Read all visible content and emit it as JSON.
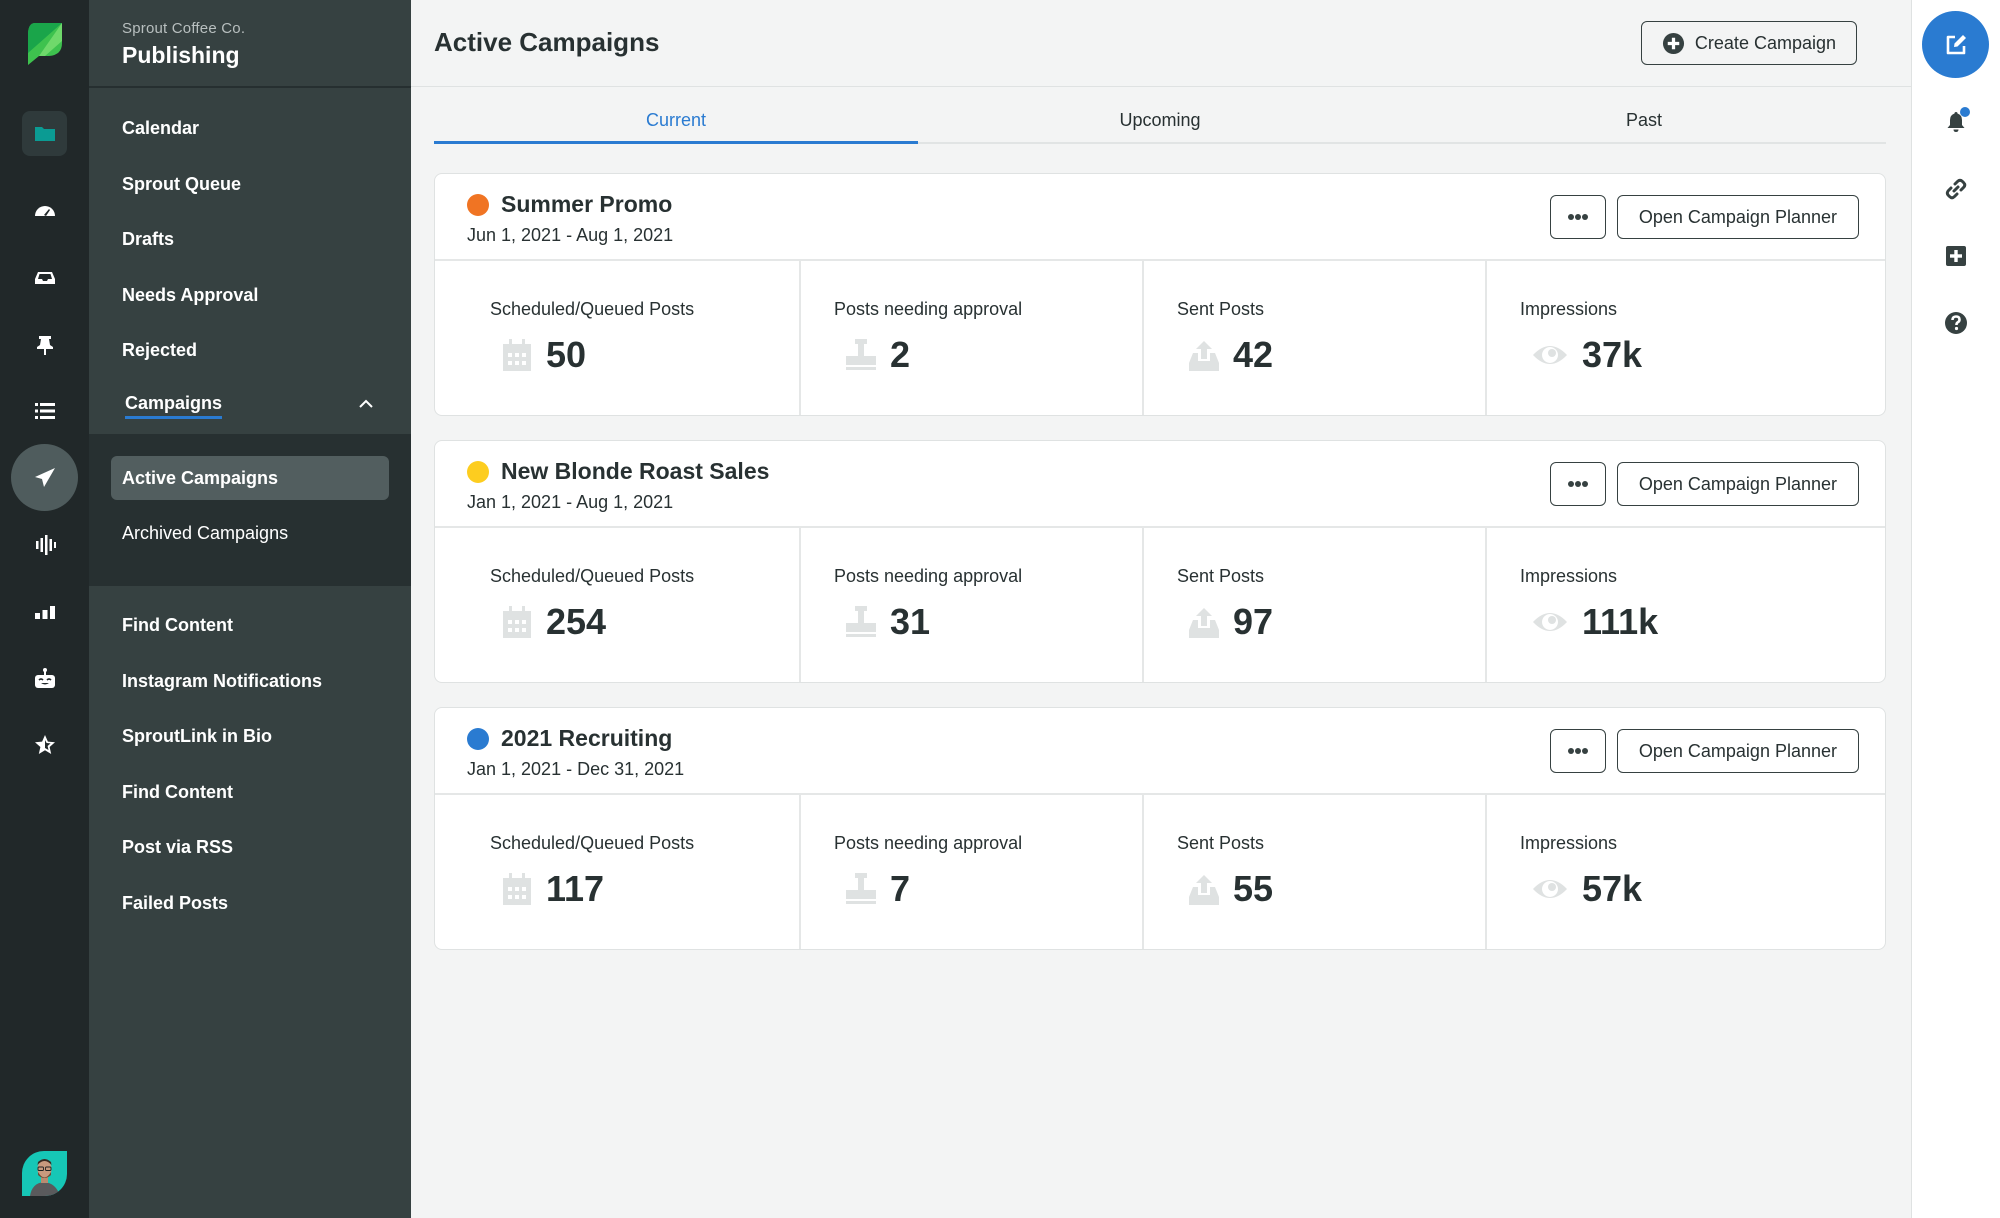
{
  "colors": {
    "accent": "#2a7bd1",
    "rail_bg": "#212829",
    "sidebar_bg": "#364141",
    "brand_green": "#59cb59"
  },
  "rail": {
    "items": [
      {
        "icon": "folder-icon",
        "label": "Publishing folder"
      },
      {
        "icon": "dashboard-gauge-icon",
        "label": "Dashboard"
      },
      {
        "icon": "inbox-icon",
        "label": "Inbox"
      },
      {
        "icon": "pin-icon",
        "label": "Tasks"
      },
      {
        "icon": "list-icon",
        "label": "Feeds"
      },
      {
        "icon": "paper-plane-icon",
        "label": "Publishing"
      },
      {
        "icon": "audio-wave-icon",
        "label": "Listening"
      },
      {
        "icon": "bar-chart-icon",
        "label": "Reports"
      },
      {
        "icon": "bot-icon",
        "label": "Automation"
      },
      {
        "icon": "star-icon",
        "label": "Reviews"
      }
    ]
  },
  "sidebar": {
    "org": "Sprout Coffee Co.",
    "title": "Publishing",
    "items": [
      "Calendar",
      "Sprout Queue",
      "Drafts",
      "Needs Approval",
      "Rejected"
    ],
    "campaigns": {
      "label": "Campaigns",
      "expanded": true,
      "subitems": [
        {
          "label": "Active Campaigns",
          "selected": true
        },
        {
          "label": "Archived Campaigns",
          "selected": false
        }
      ]
    },
    "items_after": [
      "Find Content",
      "Instagram Notifications",
      "SproutLink in Bio",
      "Find Content",
      "Post via RSS",
      "Failed Posts"
    ]
  },
  "header": {
    "title": "Active Campaigns",
    "create_button": "Create Campaign"
  },
  "tabs": [
    {
      "label": "Current",
      "active": true
    },
    {
      "label": "Upcoming",
      "active": false
    },
    {
      "label": "Past",
      "active": false
    }
  ],
  "stat_labels": {
    "scheduled": "Scheduled/Queued Posts",
    "approval": "Posts needing approval",
    "sent": "Sent Posts",
    "impressions": "Impressions"
  },
  "card_buttons": {
    "more": "More options",
    "planner": "Open Campaign Planner"
  },
  "campaigns": [
    {
      "name": "Summer Promo",
      "dates": "Jun 1, 2021 - Aug 1, 2021",
      "color": "#f07423",
      "scheduled": "50",
      "approval": "2",
      "sent": "42",
      "impressions": "37k"
    },
    {
      "name": "New Blonde Roast Sales",
      "dates": "Jan 1, 2021 - Aug 1, 2021",
      "color": "#fdcd1f",
      "scheduled": "254",
      "approval": "31",
      "sent": "97",
      "impressions": "111k"
    },
    {
      "name": "2021 Recruiting",
      "dates": "Jan 1, 2021 - Dec 31, 2021",
      "color": "#2a7bd1",
      "scheduled": "117",
      "approval": "7",
      "sent": "55",
      "impressions": "57k"
    }
  ],
  "right_rail": {
    "compose": "compose-icon",
    "items": [
      "notifications-bell-icon",
      "link-icon",
      "plus-square-icon",
      "help-icon"
    ],
    "notification_badge": true
  }
}
